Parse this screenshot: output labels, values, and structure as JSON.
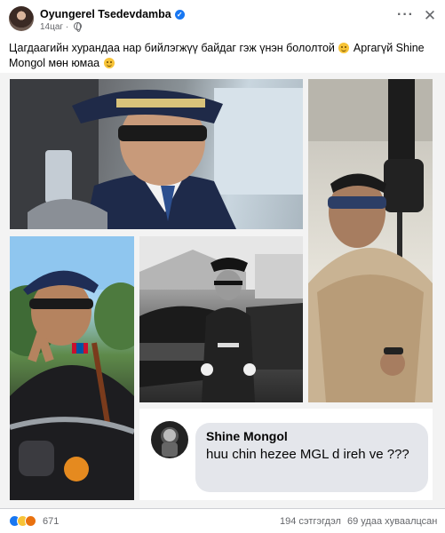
{
  "post": {
    "author": "Oyungerel Tsedevdamba",
    "time": "14цаг",
    "text": "Цагдаагийн хурандаа нар бийлэгжүү байдаг гэж үнэн бололтой",
    "text_2": "Аргагүй Shine Mongol мөн юмаа",
    "icons": {
      "verified": "verified-badge-icon",
      "audience": "globe-icon",
      "more": "more-options-icon",
      "close": "close-icon",
      "emoji_1": "thinking-face-emoji",
      "emoji_2": "smirk-face-emoji"
    }
  },
  "collage": {
    "comment": {
      "name": "Shine Mongol",
      "text": "huu chin hezee MGL d ireh ve ???"
    }
  },
  "footer": {
    "reaction_count": "671",
    "comments": "194 сэтгэгдэл",
    "shares": "69 удаа хуваалцсан",
    "reaction_icons": [
      "like-icon",
      "haha-icon",
      "angry-icon"
    ]
  },
  "colors": {
    "accent": "#1877f2",
    "text": "#050505",
    "muted": "#65676b",
    "bubble": "#e4e6eb"
  }
}
